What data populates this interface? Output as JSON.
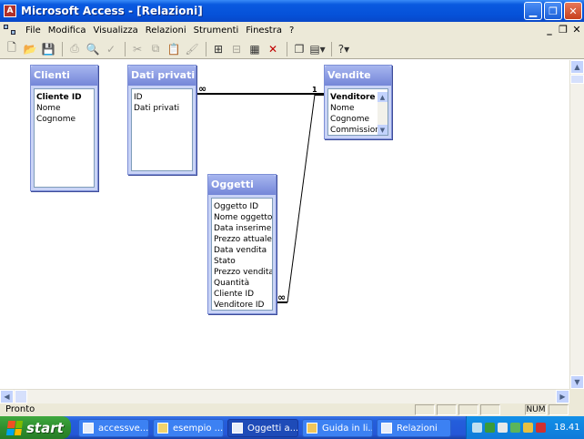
{
  "window": {
    "title": "Microsoft Access - [Relazioni]",
    "app_icon_label": "A"
  },
  "menu": {
    "items": [
      "File",
      "Modifica",
      "Visualizza",
      "Relazioni",
      "Strumenti",
      "Finestra",
      "?"
    ]
  },
  "tables": {
    "clienti": {
      "title": "Clienti",
      "fields": [
        "Cliente ID",
        "Nome",
        "Cognome"
      ]
    },
    "dati_privati": {
      "title": "Dati privati",
      "fields": [
        "ID",
        "Dati privati"
      ]
    },
    "vendite": {
      "title": "Vendite",
      "fields": [
        "Venditore ID",
        "Nome",
        "Cognome",
        "Commissione"
      ]
    },
    "oggetti": {
      "title": "Oggetti",
      "fields": [
        "Oggetto ID",
        "Nome oggetto",
        "Data inserimento",
        "Prezzo attuale",
        "Data vendita",
        "Stato",
        "Prezzo vendita",
        "Quantità",
        "Cliente ID",
        "Venditore ID"
      ]
    }
  },
  "relationships": [
    {
      "from": "Dati privati",
      "to": "Vendite",
      "from_label": "∞",
      "to_label": "1"
    },
    {
      "from": "Oggetti",
      "to": "Vendite",
      "from_label": "∞",
      "to_label": ""
    }
  ],
  "status": {
    "text": "Pronto",
    "num_indicator": "NUM"
  },
  "taskbar": {
    "start_label": "start",
    "tasks": [
      "accessve...",
      "esempio ...",
      "Oggetti a...",
      "Guida in li...",
      "Relazioni"
    ],
    "active_task": "Oggetti a...",
    "clock": "18.41"
  }
}
